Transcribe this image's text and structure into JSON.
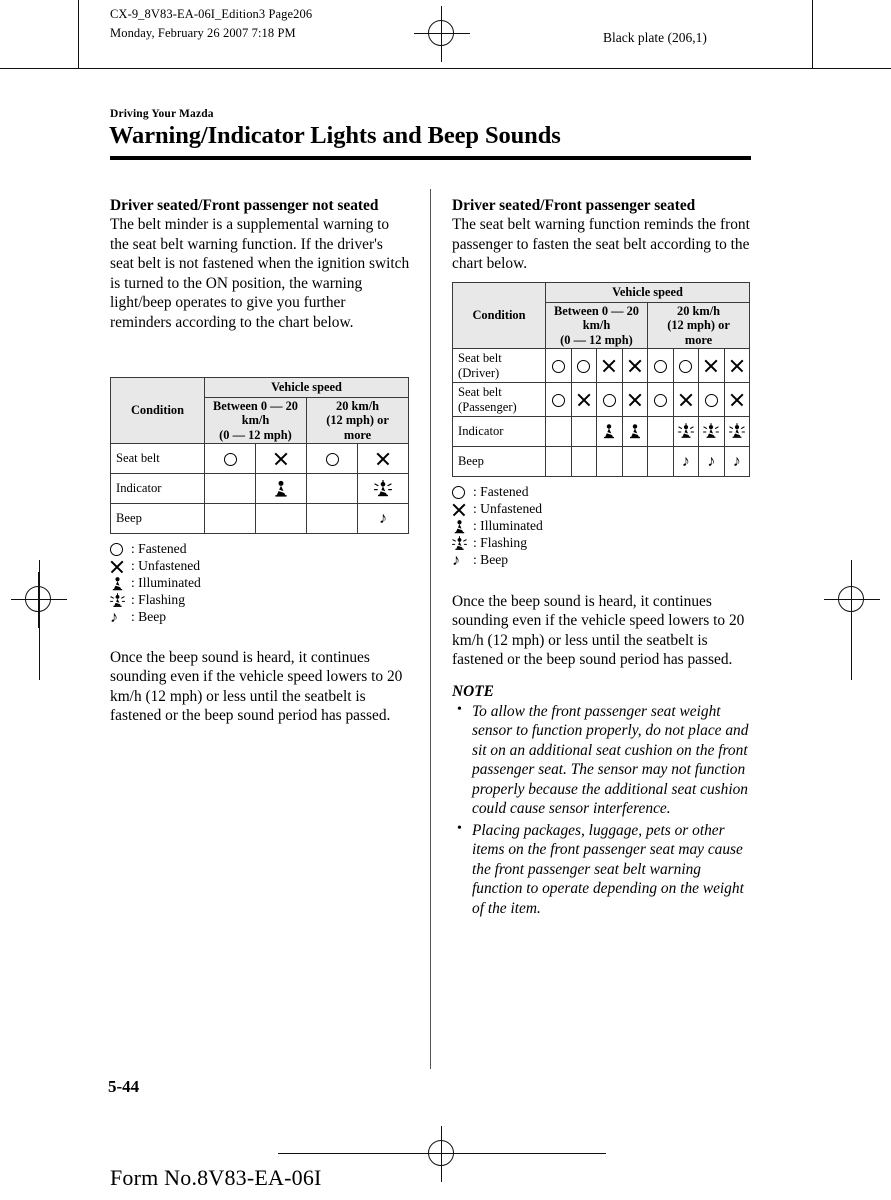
{
  "header": {
    "file_line1": "CX-9_8V83-EA-06I_Edition3 Page206",
    "file_line2": "Monday, February 26 2007 7:18 PM",
    "plate": "Black plate (206,1)"
  },
  "title": {
    "kicker": "Driving Your Mazda",
    "heading": "Warning/Indicator Lights and Beep Sounds"
  },
  "left_column": {
    "subheading": "Driver seated/Front passenger not seated",
    "intro": "The belt minder is a supplemental warning to the seat belt warning function. If the driver's seat belt is not fastened when the ignition switch is turned to the ON position, the warning light/beep operates to give you further reminders according to the chart below.",
    "closing": "Once the beep sound is heard, it continues sounding even if the vehicle speed lowers to 20 km/h (12 mph) or less until the seatbelt is fastened or the beep sound period has passed."
  },
  "right_column": {
    "subheading": "Driver seated/Front passenger seated",
    "intro": "The seat belt warning function reminds the front passenger to fasten the seat belt according to the chart below.",
    "closing": "Once the beep sound is heard, it continues sounding even if the vehicle speed lowers to 20 km/h (12 mph) or less until the seatbelt is fastened or the beep sound period has passed.",
    "note_heading": "NOTE",
    "notes": [
      "To allow the front passenger seat weight sensor to function properly, do not place and sit on an additional seat cushion on the front passenger seat. The sensor may not function properly because the additional seat cushion could cause sensor interference.",
      "Placing packages, luggage, pets or other items on the front passenger seat may cause the front passenger seat belt warning function to operate depending on the weight of the item."
    ]
  },
  "chart_data": [
    {
      "type": "table",
      "title": "Driver seated/Front passenger not seated",
      "col_group_header": "Vehicle speed",
      "condition_header": "Condition",
      "speed_groups": [
        {
          "label": "Between 0 — 20 km/h\n(0 — 12 mph)",
          "columns": 2
        },
        {
          "label": "20 km/h\n(12 mph) or more",
          "columns": 2
        }
      ],
      "rows": [
        {
          "label": "Seat belt",
          "values": [
            "fastened",
            "unfastened",
            "fastened",
            "unfastened"
          ]
        },
        {
          "label": "Indicator",
          "values": [
            "",
            "illuminated",
            "",
            "flashing"
          ]
        },
        {
          "label": "Beep",
          "values": [
            "",
            "",
            "",
            "beep"
          ]
        }
      ]
    },
    {
      "type": "table",
      "title": "Driver seated/Front passenger seated",
      "col_group_header": "Vehicle speed",
      "condition_header": "Condition",
      "speed_groups": [
        {
          "label": "Between 0 — 20 km/h\n(0 — 12 mph)",
          "columns": 4
        },
        {
          "label": "20 km/h\n(12 mph) or more",
          "columns": 4
        }
      ],
      "rows": [
        {
          "label": "Seat belt\n(Driver)",
          "values": [
            "fastened",
            "fastened",
            "unfastened",
            "unfastened",
            "fastened",
            "fastened",
            "unfastened",
            "unfastened"
          ]
        },
        {
          "label": "Seat belt\n(Passenger)",
          "values": [
            "fastened",
            "unfastened",
            "fastened",
            "unfastened",
            "fastened",
            "unfastened",
            "fastened",
            "unfastened"
          ]
        },
        {
          "label": "Indicator",
          "values": [
            "",
            "",
            "illuminated",
            "illuminated",
            "",
            "flashing",
            "flashing",
            "flashing"
          ]
        },
        {
          "label": "Beep",
          "values": [
            "",
            "",
            "",
            "",
            "",
            "beep",
            "beep",
            "beep"
          ]
        }
      ]
    }
  ],
  "table_headers": {
    "vehicle_speed": "Vehicle speed",
    "condition": "Condition",
    "speed_low_l1": "Between 0 — 20",
    "speed_low_l2": "km/h",
    "speed_low_l3": "(0 — 12 mph)",
    "speed_high_l1": "20 km/h",
    "speed_high_l2": "(12 mph) or",
    "speed_high_l3": "more",
    "row_seat_belt": "Seat belt",
    "row_seat_belt_driver_l1": "Seat belt",
    "row_seat_belt_driver_l2": "(Driver)",
    "row_seat_belt_passenger_l1": "Seat belt",
    "row_seat_belt_passenger_l2": "(Passenger)",
    "row_indicator": "Indicator",
    "row_beep": "Beep"
  },
  "legend": {
    "items": [
      {
        "symbol": "circle-icon",
        "text": ": Fastened"
      },
      {
        "symbol": "cross-icon",
        "text": ": Unfastened"
      },
      {
        "symbol": "seatbelt-lamp-icon",
        "text": ": Illuminated"
      },
      {
        "symbol": "seatbelt-lamp-flashing-icon",
        "text": ": Flashing"
      },
      {
        "symbol": "music-note-icon",
        "text": ": Beep"
      }
    ]
  },
  "footer": {
    "page_number": "5-44",
    "form_number": "Form No.8V83-EA-06I"
  },
  "colors": {
    "ink": "#000000",
    "paper": "#ffffff",
    "table_header_fill": "#e8e8e8",
    "rule": "#3a3a3a"
  }
}
